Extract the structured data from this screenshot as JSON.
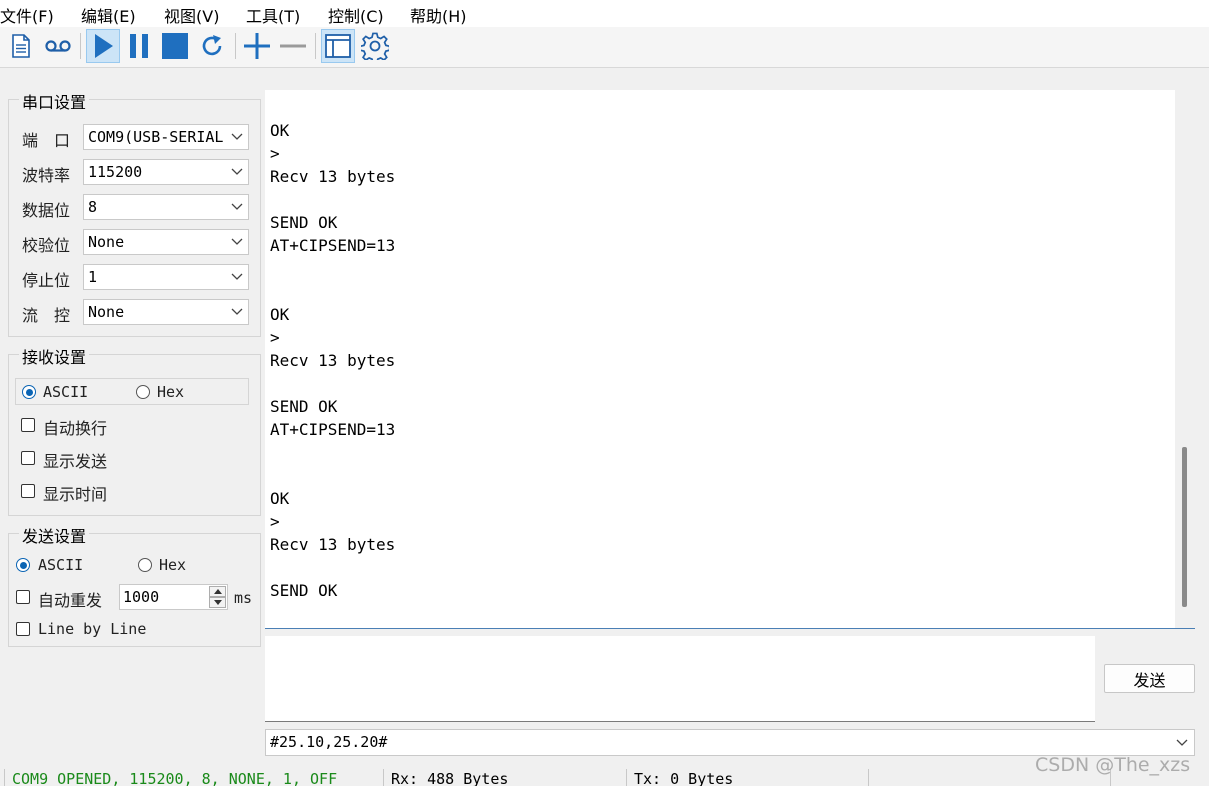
{
  "menu": {
    "items": [
      "文件(F)",
      "编辑(E)",
      "视图(V)",
      "工具(T)",
      "控制(C)",
      "帮助(H)"
    ]
  },
  "toolbar": {
    "icons": [
      "new-document-icon",
      "record-icon",
      "play-icon",
      "pause-icon",
      "stop-icon",
      "refresh-icon",
      "plus-icon",
      "minus-icon",
      "window-icon",
      "gear-icon"
    ],
    "accent_color": "#1f6fbf"
  },
  "serial": {
    "title": "串口设置",
    "port_label": "端　口",
    "port_value": "COM9(USB-SERIAL",
    "baud_label": "波特率",
    "baud_value": "115200",
    "databits_label": "数据位",
    "databits_value": "8",
    "parity_label": "校验位",
    "parity_value": "None",
    "stopbits_label": "停止位",
    "stopbits_value": "1",
    "flow_label": "流　控",
    "flow_value": "None"
  },
  "receive": {
    "title": "接收设置",
    "ascii_label": "ASCII",
    "hex_label": "Hex",
    "mode_selected": "ASCII",
    "autowrap_label": "自动换行",
    "show_send_label": "显示发送",
    "show_time_label": "显示时间"
  },
  "send": {
    "title": "发送设置",
    "ascii_label": "ASCII",
    "hex_label": "Hex",
    "mode_selected": "ASCII",
    "auto_resend_label": "自动重发",
    "interval_value": "1000",
    "interval_unit": "ms",
    "line_by_line_label": "Line by Line",
    "send_button": "发送",
    "input_value": "",
    "history_value": "#25.10,25.20#"
  },
  "terminal": {
    "text": "OK\n>\nRecv 13 bytes\n\nSEND OK\nAT+CIPSEND=13\n\n\nOK\n>\nRecv 13 bytes\n\nSEND OK\nAT+CIPSEND=13\n\n\nOK\n>\nRecv 13 bytes\n\nSEND OK",
    "scroll_position": 0.95
  },
  "status": {
    "connection": "COM9 OPENED, 115200, 8, NONE, 1, OFF",
    "connection_color": "#1a8a1a",
    "rx": "Rx: 488 Bytes",
    "tx": "Tx: 0 Bytes"
  },
  "watermark": "CSDN @The_xzs"
}
